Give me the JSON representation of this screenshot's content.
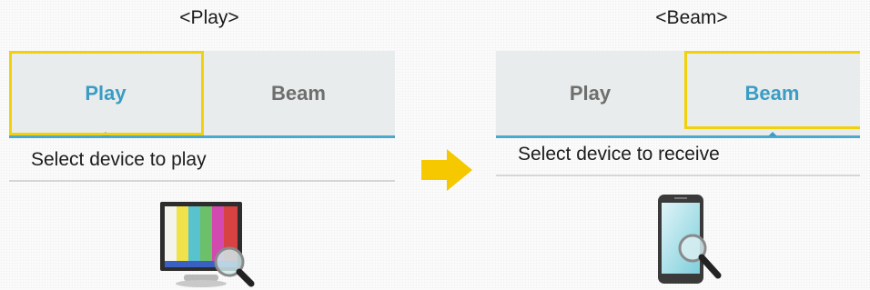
{
  "left_panel": {
    "caption": "<Play>",
    "tabs": [
      {
        "label": "Play",
        "active": true
      },
      {
        "label": "Beam",
        "active": false
      }
    ],
    "subheader": "Select device to play",
    "icon": "tv-search-icon"
  },
  "right_panel": {
    "caption": "<Beam>",
    "tabs": [
      {
        "label": "Play",
        "active": false
      },
      {
        "label": "Beam",
        "active": true
      }
    ],
    "subheader": "Select device to receive",
    "icon": "phone-search-icon"
  },
  "transition_arrow": "right-arrow-icon",
  "colors": {
    "highlight": "#f2d10a",
    "active_tab": "#3b9cc4",
    "inactive_tab": "#6e6e6e",
    "tab_underline": "#4aa9cc",
    "arrow": "#f5c800"
  }
}
